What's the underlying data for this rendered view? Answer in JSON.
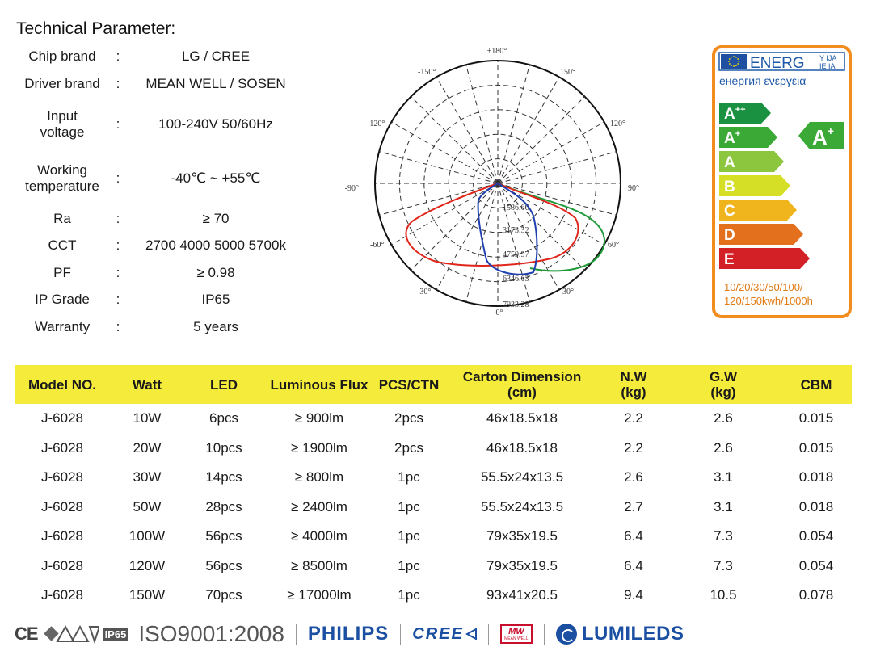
{
  "technical": {
    "title": "Technical Parameter:",
    "colon": ":",
    "rows": [
      {
        "label": "Chip brand",
        "value": "LG / CREE"
      },
      {
        "label": "Driver brand",
        "value": "MEAN WELL / SOSEN"
      },
      {
        "label_line1": "Input",
        "label_line2": "voltage",
        "value": "100-240V 50/60Hz"
      },
      {
        "label_line1": "Working",
        "label_line2": "temperature",
        "value": "-40℃ ~ +55℃"
      },
      {
        "label": "Ra",
        "value": "≥ 70"
      },
      {
        "label": "CCT",
        "value": "2700 4000 5000 5700k"
      },
      {
        "label": "PF",
        "value": "≥ 0.98"
      },
      {
        "label": "IP Grade",
        "value": "IP65"
      },
      {
        "label": "Warranty",
        "value": "5 years"
      }
    ]
  },
  "polar_chart": {
    "angle_labels": {
      "top": "±180°",
      "bottom": "0°",
      "left": "-90°",
      "right": "90°",
      "n150": "-150°",
      "p150": "150°",
      "n120": "-120°",
      "p120": "120°",
      "n60": "-60°",
      "p60": "60°",
      "n30": "-30°",
      "p30": "30°"
    },
    "radial_labels": [
      "1586.66",
      "3173.32",
      "4759.97",
      "6346.63",
      "7933.28"
    ],
    "curve_colors": {
      "red": "#e0251b",
      "green": "#1f9a3a",
      "blue": "#1f3fb0"
    }
  },
  "energy_label": {
    "header": "ENERG",
    "header_suffix_top": "Y IJA",
    "header_suffix_bottom": "IE IA",
    "subheader": "енергия ενεργεια",
    "classes": [
      {
        "letter": "A",
        "sup": "++",
        "color": "#1a9140"
      },
      {
        "letter": "A",
        "sup": "+",
        "color": "#3aa935"
      },
      {
        "letter": "A",
        "sup": "",
        "color": "#8cc63f"
      },
      {
        "letter": "B",
        "sup": "",
        "color": "#d5df26"
      },
      {
        "letter": "C",
        "sup": "",
        "color": "#f0b41d"
      },
      {
        "letter": "D",
        "sup": "",
        "color": "#e2701c"
      },
      {
        "letter": "E",
        "sup": "",
        "color": "#d31f26"
      }
    ],
    "rating": {
      "letter": "A",
      "sup": "+"
    },
    "footer_line1": "10/20/30/50/100/",
    "footer_line2": "120/150kwh/1000h",
    "border_color": "#f28c1e"
  },
  "table": {
    "headers": [
      "Model NO.",
      "Watt",
      "LED",
      "Luminous Flux",
      "PCS/CTN",
      "Carton Dimension",
      "N.W",
      "G.W",
      "CBM"
    ],
    "header_sub": {
      "carton": "(cm)",
      "nw": "(kg)",
      "gw": "(kg)"
    },
    "rows": [
      [
        "J-6028",
        "10W",
        "6pcs",
        "≥ 900lm",
        "2pcs",
        "46x18.5x18",
        "2.2",
        "2.6",
        "0.015"
      ],
      [
        "J-6028",
        "20W",
        "10pcs",
        "≥ 1900lm",
        "2pcs",
        "46x18.5x18",
        "2.2",
        "2.6",
        "0.015"
      ],
      [
        "J-6028",
        "30W",
        "14pcs",
        "≥ 800lm",
        "1pc",
        "55.5x24x13.5",
        "2.6",
        "3.1",
        "0.018"
      ],
      [
        "J-6028",
        "50W",
        "28pcs",
        "≥ 2400lm",
        "1pc",
        "55.5x24x13.5",
        "2.7",
        "3.1",
        "0.018"
      ],
      [
        "J-6028",
        "100W",
        "56pcs",
        "≥ 4000lm",
        "1pc",
        "79x35x19.5",
        "6.4",
        "7.3",
        "0.054"
      ],
      [
        "J-6028",
        "120W",
        "56pcs",
        "≥ 8500lm",
        "1pc",
        "79x35x19.5",
        "6.4",
        "7.3",
        "0.054"
      ],
      [
        "J-6028",
        "150W",
        "70pcs",
        "≥ 17000lm",
        "1pc",
        "93x41x20.5",
        "9.4",
        "10.5",
        "0.078"
      ]
    ],
    "header_color": "#f5eb3a"
  },
  "footer": {
    "ce": "CE",
    "ip65": "IP65",
    "iso": "ISO9001:2008",
    "philips": "PHILIPS",
    "cree": "CREE",
    "mw_top": "MW",
    "mw_bottom": "MEAN WELL",
    "lumileds": "LUMILEDS"
  }
}
